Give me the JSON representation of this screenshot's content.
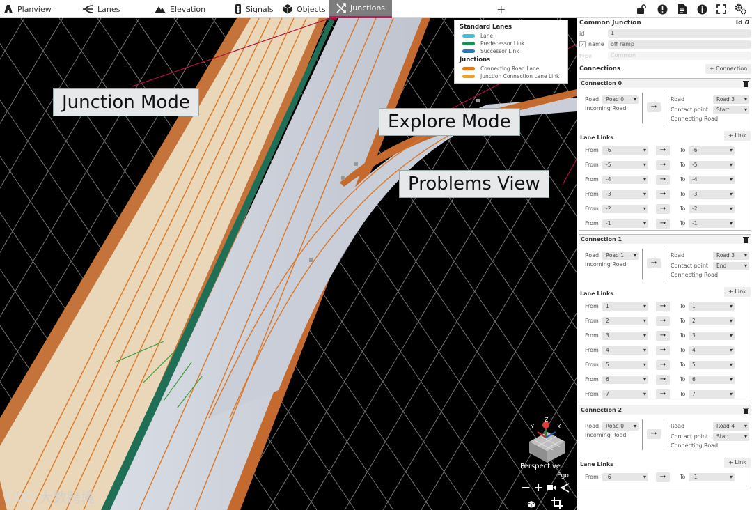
{
  "toolbar": {
    "items": [
      {
        "label": "Planview",
        "icon": "planview-icon"
      },
      {
        "label": "Lanes",
        "icon": "lanes-icon"
      },
      {
        "label": "Elevation",
        "icon": "elevation-icon"
      },
      {
        "label": "Signals",
        "icon": "signals-icon"
      },
      {
        "label": "Objects",
        "icon": "objects-icon"
      },
      {
        "label": "Junctions",
        "icon": "junctions-icon",
        "active": true
      }
    ],
    "add_label": "+",
    "right_icons": [
      "lock-icon",
      "problems-icon",
      "document-icon",
      "info-icon",
      "fullscreen-icon",
      "settings-icon"
    ]
  },
  "legend": {
    "standard_heading": "Standard Lanes",
    "standard": [
      {
        "label": "Lane",
        "color": "#39c3d7"
      },
      {
        "label": "Predecessor Link",
        "color": "#1f8a5a"
      },
      {
        "label": "Successor Link",
        "color": "#1b7fbf"
      }
    ],
    "junctions_heading": "Junctions",
    "junctions": [
      {
        "label": "Connecting Road Lane",
        "color": "#e07a1f"
      },
      {
        "label": "Junction Connection Lane Link",
        "color": "#f2a21c"
      }
    ]
  },
  "callouts": {
    "junction_mode": "Junction Mode",
    "explore_mode": "Explore Mode",
    "problems_view": "Problems View"
  },
  "view_cube": {
    "axis_y": "Y",
    "axis_z": "Z",
    "axis_x": "X",
    "projection": "Perspective",
    "camera": "Ego"
  },
  "view_controls": {
    "zoom_out": "−",
    "zoom_in": "+"
  },
  "watermark": "大数跨境",
  "panel": {
    "title": "Common Junction",
    "id_label": "Id",
    "id_value": "0",
    "props": {
      "id_label": "id",
      "id_value": "1",
      "name_label": "name",
      "name_value": "off ramp",
      "type_label": "type",
      "type_value": "Common"
    },
    "connections_label": "Connections",
    "add_connection_label": "+ Connection",
    "road_label": "Road",
    "incoming_label": "Incoming Road",
    "contact_label": "Contact point",
    "connecting_label": "Connecting Road",
    "lane_links_label": "Lane Links",
    "add_link_label": "+ Link",
    "from_label": "From",
    "to_label": "To",
    "arrow": "→",
    "connections": [
      {
        "title": "Connection 0",
        "incoming_road": "Road 0",
        "connecting_road": "Road 3",
        "contact_point": "Start",
        "links": [
          {
            "from": "-6",
            "to": "-6"
          },
          {
            "from": "-5",
            "to": "-5"
          },
          {
            "from": "-4",
            "to": "-4"
          },
          {
            "from": "-3",
            "to": "-3"
          },
          {
            "from": "-2",
            "to": "-2"
          },
          {
            "from": "-1",
            "to": "-1"
          }
        ]
      },
      {
        "title": "Connection 1",
        "incoming_road": "Road 1",
        "connecting_road": "Road 3",
        "contact_point": "End",
        "links": [
          {
            "from": "1",
            "to": "1"
          },
          {
            "from": "2",
            "to": "2"
          },
          {
            "from": "3",
            "to": "3"
          },
          {
            "from": "4",
            "to": "4"
          },
          {
            "from": "5",
            "to": "5"
          },
          {
            "from": "6",
            "to": "6"
          },
          {
            "from": "7",
            "to": "7"
          }
        ]
      },
      {
        "title": "Connection 2",
        "incoming_road": "Road 0",
        "connecting_road": "Road 4",
        "contact_point": "Start",
        "links": [
          {
            "from": "-6",
            "to": "-1"
          }
        ]
      }
    ]
  }
}
